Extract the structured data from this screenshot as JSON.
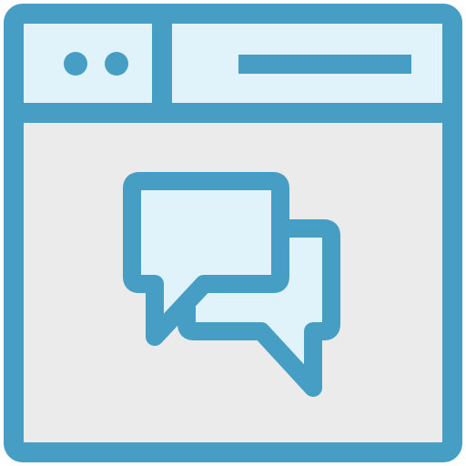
{
  "icon": {
    "name": "browser-chat-icon",
    "parts": [
      "browser-window-icon",
      "window-dots-icon",
      "address-bar-icon",
      "chat-bubbles-icon"
    ]
  },
  "colors": {
    "stroke": "#469ec4",
    "header_fill": "#e0f3fb",
    "body_fill": "#ebebeb",
    "bubble_fill": "#e0f3fb"
  }
}
